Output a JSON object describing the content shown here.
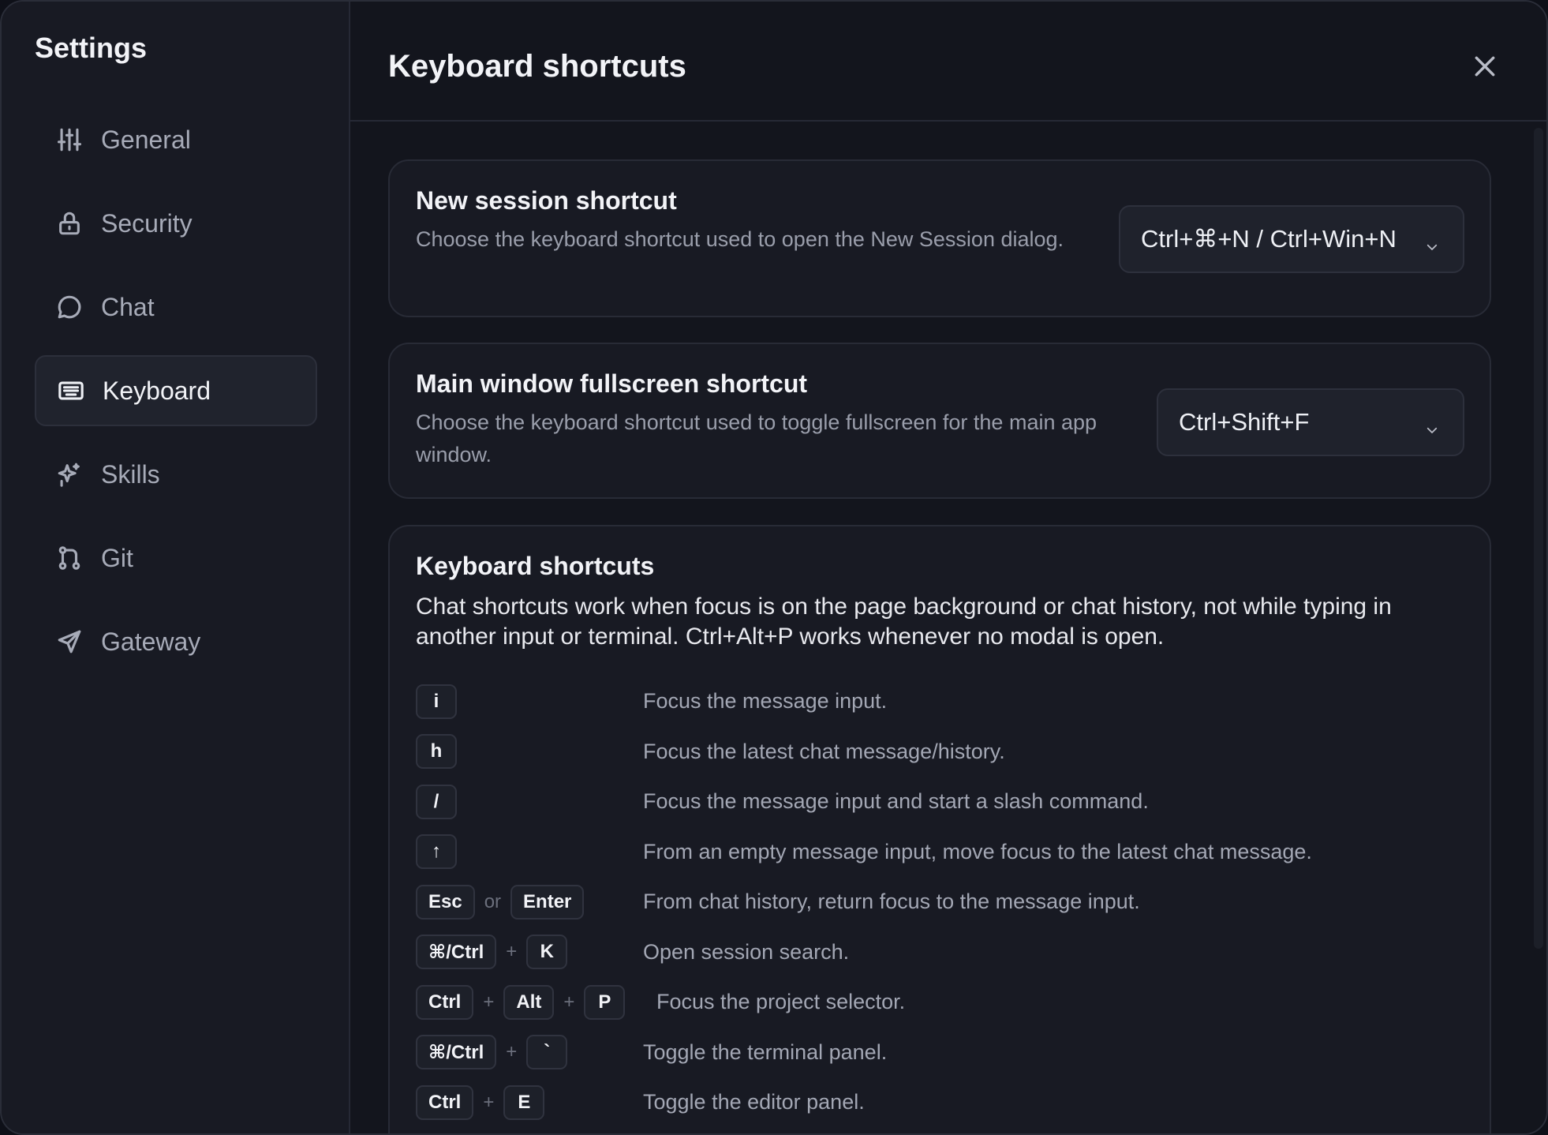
{
  "sidebar": {
    "title": "Settings",
    "items": [
      {
        "label": "General",
        "icon": "sliders-icon"
      },
      {
        "label": "Security",
        "icon": "lock-icon"
      },
      {
        "label": "Chat",
        "icon": "chat-bubble-icon"
      },
      {
        "label": "Keyboard",
        "icon": "keyboard-icon",
        "active": true
      },
      {
        "label": "Skills",
        "icon": "sparkle-icon"
      },
      {
        "label": "Git",
        "icon": "git-branch-icon"
      },
      {
        "label": "Gateway",
        "icon": "send-icon"
      }
    ]
  },
  "header": {
    "title": "Keyboard shortcuts",
    "close_icon": "close-icon"
  },
  "new_session": {
    "title": "New session shortcut",
    "description": "Choose the keyboard shortcut used to open the New Session dialog.",
    "selected": "Ctrl+⌘+N / Ctrl+Win+N"
  },
  "fullscreen": {
    "title": "Main window fullscreen shortcut",
    "description": "Choose the keyboard shortcut used to toggle fullscreen for the main app window.",
    "selected": "Ctrl+Shift+F"
  },
  "shortcuts": {
    "title": "Keyboard shortcuts",
    "description": "Chat shortcuts work when focus is on the page background or chat history, not while typing in another input or terminal. Ctrl+Alt+P works whenever no modal is open.",
    "or_label": "or",
    "plus_label": "+",
    "rows": [
      {
        "keys": [
          "i"
        ],
        "desc": "Focus the message input."
      },
      {
        "keys": [
          "h"
        ],
        "desc": "Focus the latest chat message/history."
      },
      {
        "keys": [
          "/"
        ],
        "desc": "Focus the message input and start a slash command."
      },
      {
        "keys": [
          "↑"
        ],
        "desc": "From an empty message input, move focus to the latest chat message."
      },
      {
        "keys": [
          "Esc",
          "Enter"
        ],
        "desc": "From chat history, return focus to the message input."
      },
      {
        "keys": [
          "⌘/Ctrl",
          "K"
        ],
        "desc": "Open session search."
      },
      {
        "keys": [
          "Ctrl",
          "Alt",
          "P"
        ],
        "desc": "Focus the project selector."
      },
      {
        "keys": [
          "⌘/Ctrl",
          "`"
        ],
        "desc": "Toggle the terminal panel."
      },
      {
        "keys": [
          "Ctrl",
          "E"
        ],
        "desc": "Toggle the editor panel."
      }
    ]
  }
}
